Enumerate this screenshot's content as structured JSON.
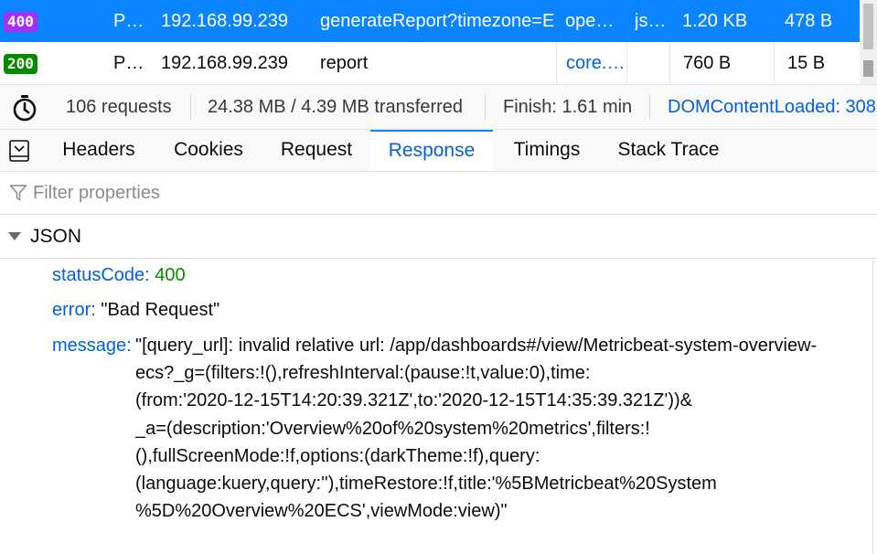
{
  "requests": [
    {
      "status": "400",
      "method": "P…",
      "domain": "192.168.99.239",
      "file": "generateReport?timezone=E",
      "initiator": "ope…",
      "type": "js…",
      "transferred": "1.20 KB",
      "size": "478 B",
      "selected": true
    },
    {
      "status": "200",
      "method": "P…",
      "domain": "192.168.99.239",
      "file": "report",
      "initiator": "core.…",
      "type": "",
      "transferred": "760 B",
      "size": "15 B",
      "selected": false
    }
  ],
  "status_bar": {
    "requests": "106 requests",
    "transferred": "24.38 MB / 4.39 MB transferred",
    "finish": "Finish: 1.61 min",
    "dom_content_loaded": "DOMContentLoaded: 308"
  },
  "tabs": [
    {
      "id": "headers",
      "label": "Headers"
    },
    {
      "id": "cookies",
      "label": "Cookies"
    },
    {
      "id": "request",
      "label": "Request"
    },
    {
      "id": "response",
      "label": "Response",
      "active": true
    },
    {
      "id": "timings",
      "label": "Timings"
    },
    {
      "id": "stack-trace",
      "label": "Stack Trace"
    }
  ],
  "filter": {
    "placeholder": "Filter properties",
    "value": ""
  },
  "json_section": {
    "title": "JSON",
    "properties": {
      "statusCode": {
        "key": "statusCode:",
        "value": "400"
      },
      "error": {
        "key": "error:",
        "value": "\"Bad Request\""
      },
      "message": {
        "key": "message:",
        "lines": [
          "\"[query_url]: invalid relative url: /app/dashboards#/view/Metricbeat-system-overview-",
          "ecs?_g=(filters:!(),refreshInterval:(pause:!t,value:0),time:",
          "(from:'2020-12-15T14:20:39.321Z',to:'2020-12-15T14:35:39.321Z'))&",
          "_a=(description:'Overview%20of%20system%20metrics',filters:!",
          "(),fullScreenMode:!f,options:(darkTheme:!f),query:",
          "(language:kuery,query:''),timeRestore:!f,title:'%5BMetricbeat%20System",
          "%5D%20Overview%20ECS',viewMode:view)\""
        ]
      }
    }
  },
  "colors": {
    "selected_row": "#0a84ff",
    "status_400": "#a42ff5",
    "status_200": "#058b00",
    "link_blue": "#0060df",
    "number_green": "#058b00"
  },
  "icons": {
    "stopwatch": "stopwatch-icon",
    "panel_toggle": "panel-toggle-icon",
    "filter": "filter-icon",
    "twisty": "caret-down-icon"
  }
}
